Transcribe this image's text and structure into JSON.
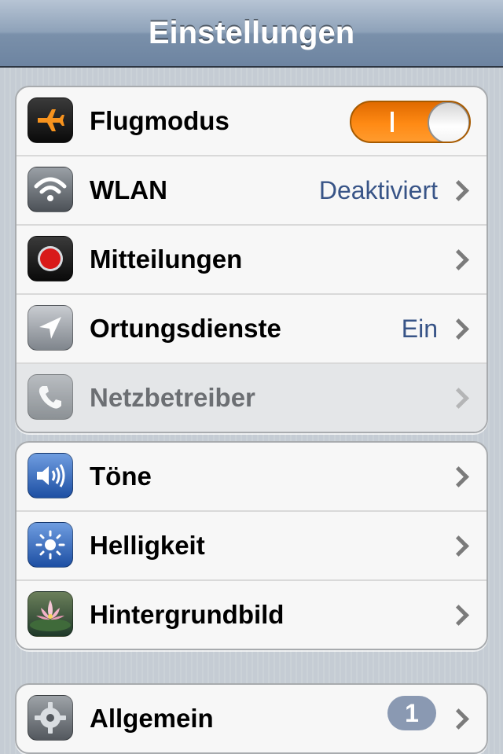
{
  "navbar": {
    "title": "Einstellungen"
  },
  "groups": [
    {
      "rows": [
        {
          "label": "Flugmodus",
          "icon": "airplane-icon",
          "toggle": {
            "on": true,
            "on_label": "I"
          }
        },
        {
          "label": "WLAN",
          "icon": "wifi-icon",
          "value": "Deaktiviert"
        },
        {
          "label": "Mitteilungen",
          "icon": "notifications-icon"
        },
        {
          "label": "Ortungsdienste",
          "icon": "location-arrow-icon",
          "value": "Ein"
        },
        {
          "label": "Netzbetreiber",
          "icon": "phone-icon",
          "disabled": true
        }
      ]
    },
    {
      "rows": [
        {
          "label": "Töne",
          "icon": "speaker-icon"
        },
        {
          "label": "Helligkeit",
          "icon": "brightness-icon"
        },
        {
          "label": "Hintergrundbild",
          "icon": "wallpaper-icon"
        }
      ]
    },
    {
      "rows": [
        {
          "label": "Allgemein",
          "icon": "gear-icon",
          "badge": "1"
        }
      ]
    }
  ],
  "colors": {
    "value_text": "#385487",
    "toggle_on": "#ff8a14",
    "badge_bg": "#8a99b2",
    "navbar": "#6d84a1"
  }
}
